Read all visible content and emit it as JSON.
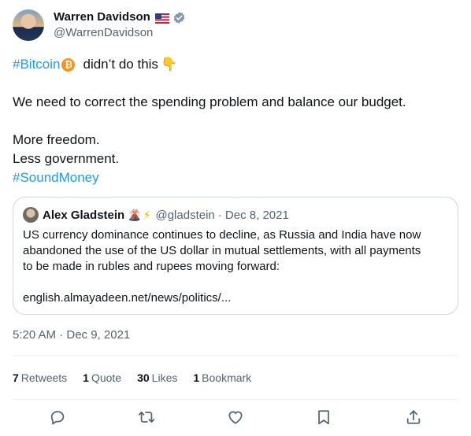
{
  "author": {
    "name": "Warren Davidson",
    "handle": "@WarrenDavidson",
    "flag": "🇺🇸",
    "verified": true
  },
  "tweet": {
    "line1_hashtag": "#Bitcoin",
    "line1_text": "didn’t do this",
    "line1_emoji": "👇",
    "line2": "We need to correct the spending problem and balance our budget.",
    "line3": "More freedom.",
    "line4": "Less government.",
    "line5_hashtag": "#SoundMoney"
  },
  "quote": {
    "name": "Alex Gladstein",
    "emoji1": "🌋",
    "emoji2": "⚡",
    "handle": "@gladstein",
    "date": "· Dec 8, 2021",
    "text_line1": "US currency dominance continues to decline, as Russia and India have now",
    "text_line2": "abandoned the use of the US dollar in mutual settlements, with all payments",
    "text_line3": "to be made in rubles and rupees moving forward:",
    "link": "english.almayadeen.net/news/politics/..."
  },
  "timestamp": "5:20 AM · Dec 9, 2021",
  "stats": {
    "retweets_count": "7",
    "retweets_label": "Retweets",
    "quotes_count": "1",
    "quotes_label": "Quote",
    "likes_count": "30",
    "likes_label": "Likes",
    "bookmarks_count": "1",
    "bookmarks_label": "Bookmark"
  },
  "icons": {
    "bitcoin": "₿",
    "actions": [
      "reply-icon",
      "retweet-icon",
      "like-icon",
      "bookmark-icon",
      "share-icon"
    ]
  },
  "colors": {
    "link": "#1d9bf0",
    "secondary": "#536471",
    "verified": "#829aab",
    "bitcoin": "#f7931a"
  }
}
